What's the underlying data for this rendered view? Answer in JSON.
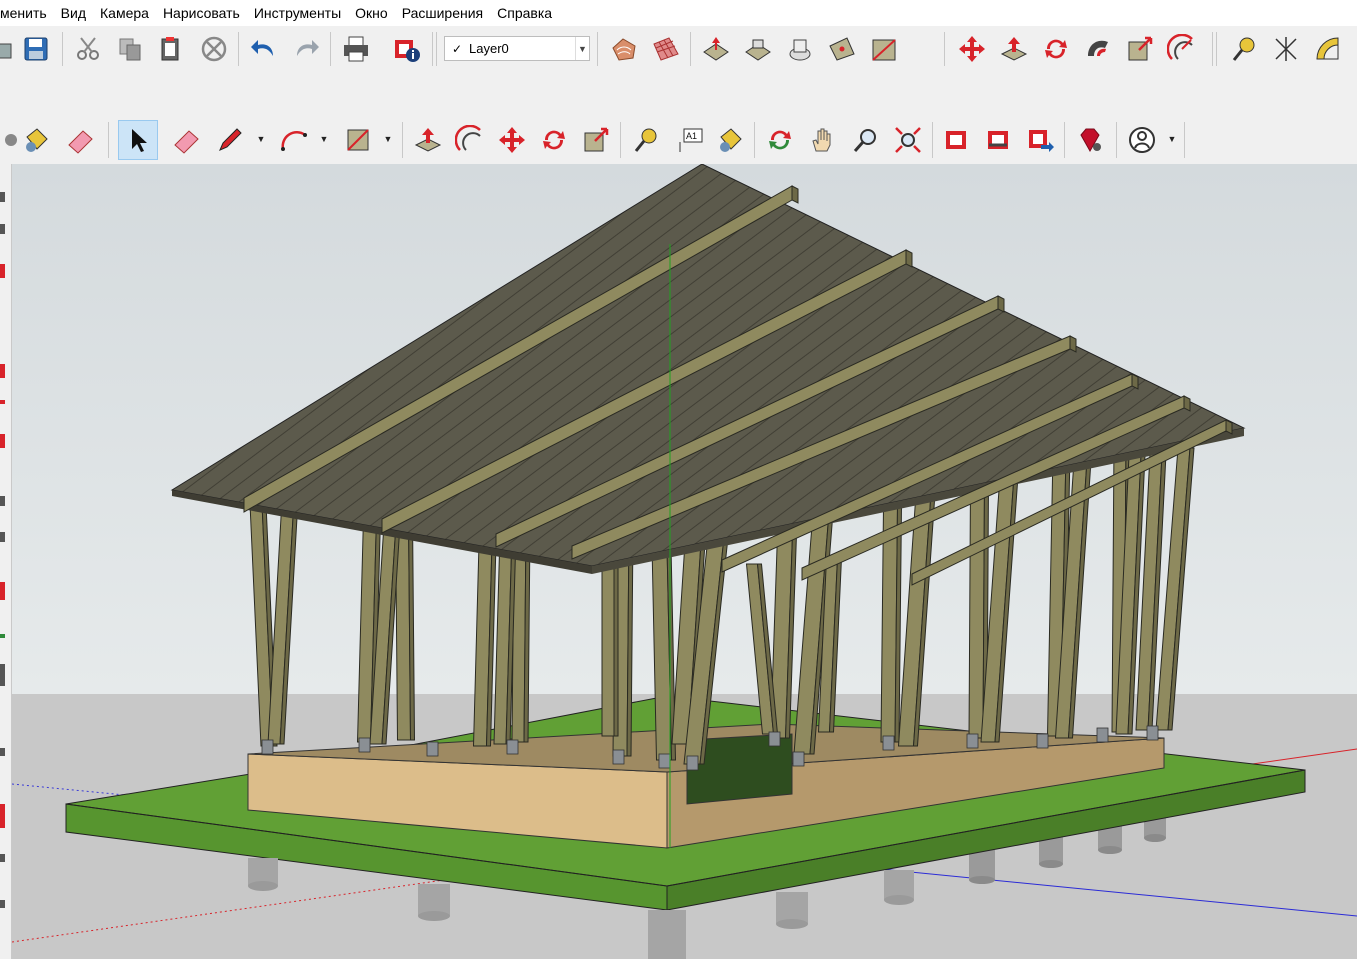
{
  "menu": {
    "items": [
      {
        "label": "менить",
        "name": "menu-edit"
      },
      {
        "label": "Вид",
        "name": "menu-view"
      },
      {
        "label": "Камера",
        "name": "menu-camera"
      },
      {
        "label": "Нарисовать",
        "name": "menu-draw"
      },
      {
        "label": "Инструменты",
        "name": "menu-tools"
      },
      {
        "label": "Окно",
        "name": "menu-window"
      },
      {
        "label": "Расширения",
        "name": "menu-extensions"
      },
      {
        "label": "Справка",
        "name": "menu-help"
      }
    ]
  },
  "layers": {
    "current": "Layer0",
    "check": "✓"
  },
  "viewport_labels": {
    "text_tool": "A1"
  },
  "colors": {
    "sky": "#dfe4e6",
    "ground": "#c9c9c9",
    "grass": "#61a035",
    "timber": "#8f8a5f",
    "platform": "#dcbd8a",
    "accent_red": "#d8232a"
  },
  "icons": [
    "save-icon",
    "cut-icon",
    "copy-icon",
    "paste-icon",
    "erase-icon",
    "undo-icon",
    "redo-icon",
    "print-icon",
    "model-info-icon",
    "sandbox-contours-icon",
    "sandbox-grid-icon",
    "smoove-icon",
    "stamp-icon",
    "drape-icon",
    "add-detail-icon",
    "flip-edge-icon",
    "move-icon",
    "pushpull-icon",
    "rotate-icon",
    "follow-me-icon",
    "scale-icon",
    "offset-icon",
    "tape-measure-icon",
    "axes-icon",
    "protractor-icon",
    "iso-view-icon",
    "top-view-icon",
    "front-view-icon",
    "right-view-icon",
    "back-view-icon",
    "left-view-icon",
    "select-icon",
    "eraser-icon",
    "pencil-icon",
    "arc-icon",
    "rectangle-icon",
    "dimension-icon",
    "text-icon",
    "paint-bucket-icon",
    "orbit-icon",
    "pan-icon",
    "zoom-icon",
    "zoom-extents-icon",
    "warehouse-icon",
    "share-model-icon",
    "extension-warehouse-icon",
    "ruby-console-icon",
    "account-icon"
  ]
}
